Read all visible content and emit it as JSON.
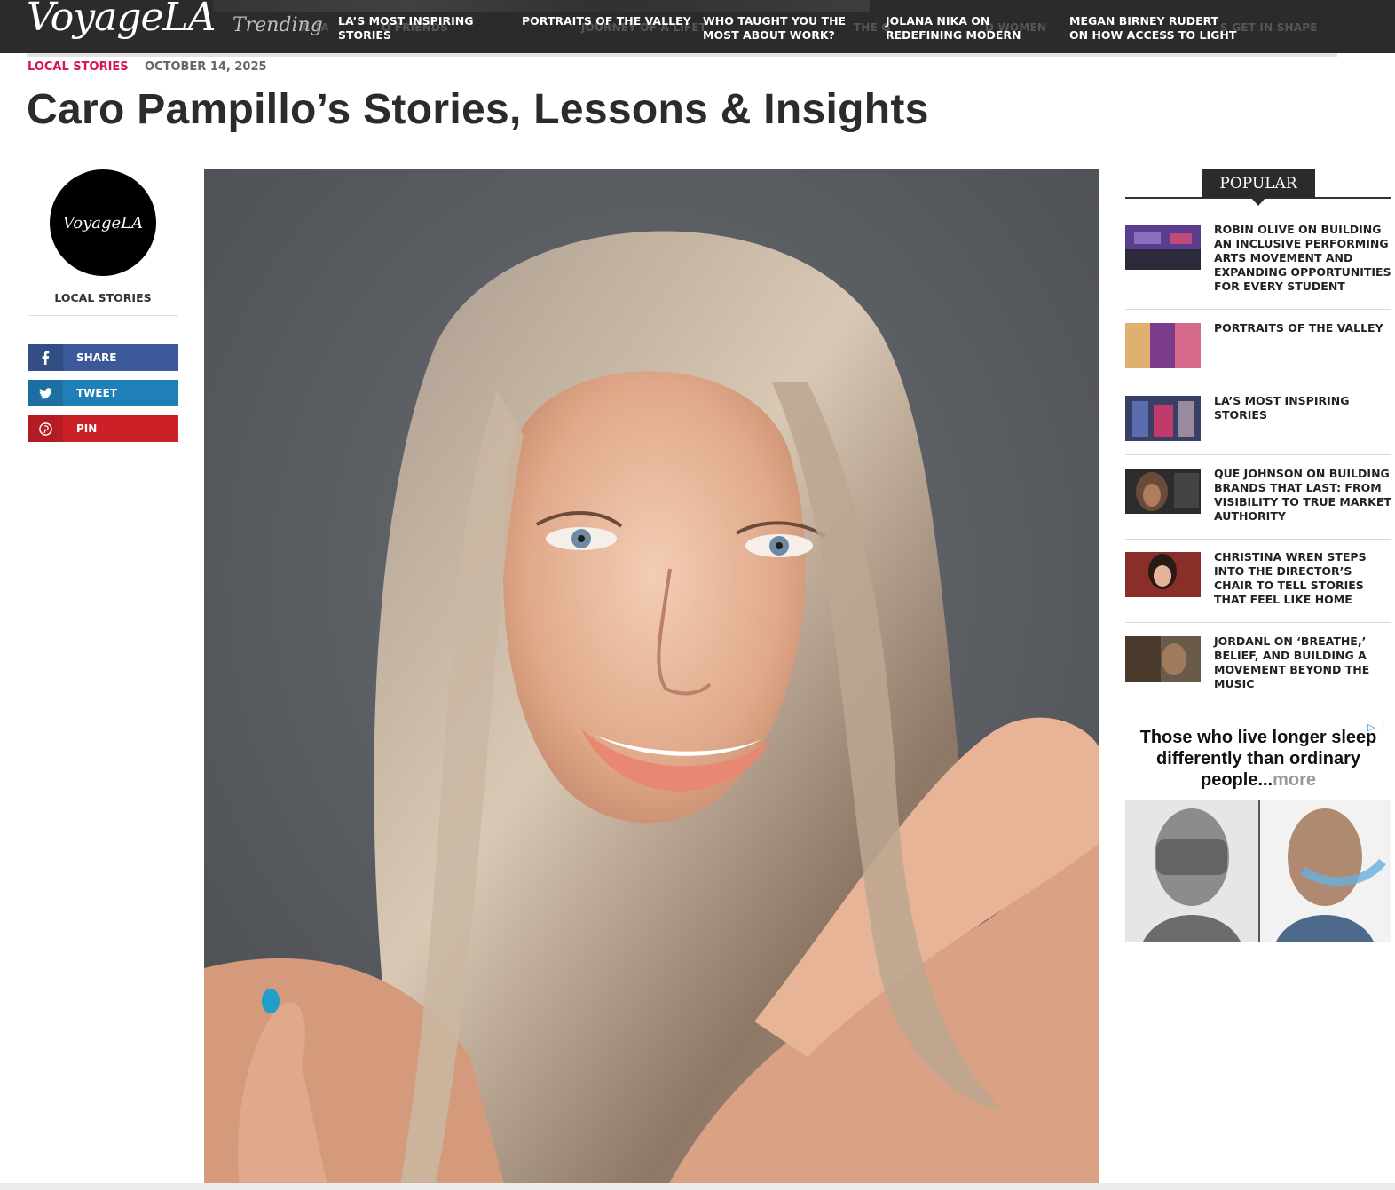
{
  "header": {
    "logo": "VoyageLA",
    "trending_label": "Trending",
    "nav": [
      {
        "line1": "LA’S MOST INSPIRING",
        "line2": "STORIES"
      },
      {
        "line1": "PORTRAITS OF THE VALLEY",
        "line2": ""
      },
      {
        "line1": "WHO TAUGHT YOU THE",
        "line2": "MOST ABOUT WORK?"
      },
      {
        "line1": "JOLANA NIKA ON",
        "line2": "REDEFINING MODERN"
      },
      {
        "line1": "MEGAN BIRNEY RUDERT",
        "line2": "ON HOW ACCESS TO LIGHT"
      }
    ],
    "ghost_text": [
      "A TA",
      "O FRIENDS",
      "JOURNEY OF A LIFET",
      "THE G",
      "D WOMEN",
      "S GET IN SHAPE"
    ]
  },
  "article": {
    "category": "LOCAL STORIES",
    "date": "OCTOBER 14, 2025",
    "title": "Caro Pampillo’s Stories, Lessons & Insights"
  },
  "author": {
    "logo": "VoyageLA",
    "category": "LOCAL STORIES"
  },
  "share": {
    "facebook": "SHARE",
    "twitter": "TWEET",
    "pinterest": "PIN"
  },
  "popular": {
    "tab": "POPULAR",
    "items": [
      {
        "title": "ROBIN OLIVE ON BUILDING AN INCLUSIVE PERFORMING ARTS MOVEMENT AND EXPANDING OPPORTUNITIES FOR EVERY STUDENT"
      },
      {
        "title": "PORTRAITS OF THE VALLEY"
      },
      {
        "title": "LA’S MOST INSPIRING STORIES"
      },
      {
        "title": "QUE JOHNSON ON BUILDING BRANDS THAT LAST: FROM VISIBILITY TO TRUE MARKET AUTHORITY"
      },
      {
        "title": "CHRISTINA WREN STEPS INTO THE DIRECTOR’S CHAIR TO TELL STORIES THAT FEEL LIKE HOME"
      },
      {
        "title": "JORDANL ON ‘BREATHE,’ BELIEF, AND BUILDING A MOVEMENT BEYOND THE MUSIC"
      }
    ]
  },
  "ad": {
    "headline": "Those who live longer sleep differently than ordinary people...",
    "more": "more",
    "adchoices": "▷ ⋮"
  },
  "colors": {
    "topbar": "#2b2b2b",
    "category": "#d5125a",
    "facebook": "#3b5998",
    "twitter": "#1f7fb8",
    "pinterest": "#cb2027"
  }
}
